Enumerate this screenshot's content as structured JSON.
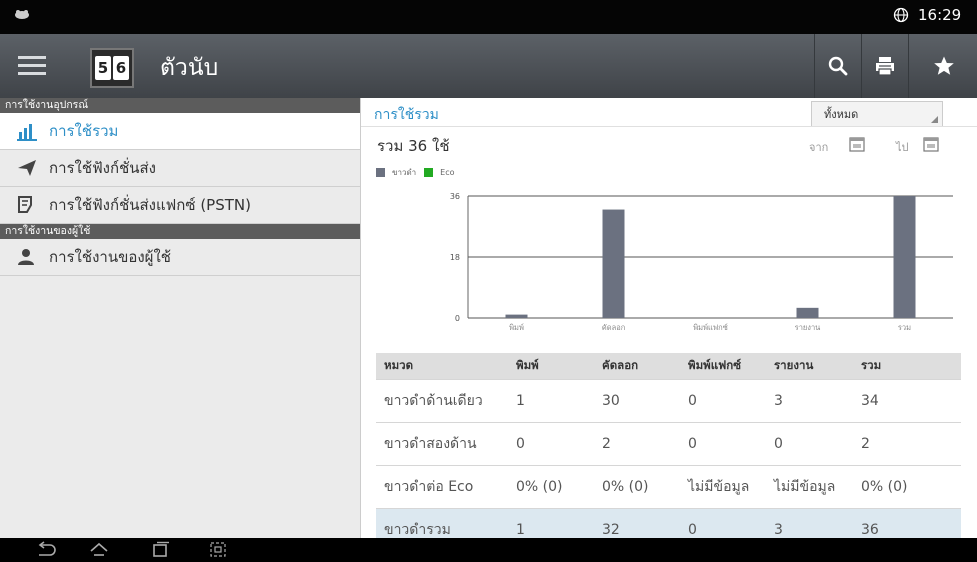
{
  "status_bar": {
    "time": "16:29",
    "left_icon": "notification-icon",
    "globe_icon": "globe-icon"
  },
  "app_bar": {
    "title": "ตัวนับ",
    "logo_left": "5",
    "logo_right": "6",
    "actions": [
      "search-icon",
      "print-icon",
      "star-icon"
    ]
  },
  "sidebar": {
    "sections": [
      {
        "header": "การใช้งานอุปกรณ์",
        "items": [
          {
            "label": "การใช้รวม",
            "icon": "bar-chart-icon",
            "active": true
          },
          {
            "label": "การใช้ฟังก์ชั่นส่ง",
            "icon": "send-icon",
            "active": false
          },
          {
            "label": "การใช้ฟังก์ชั่นส่งแฟกซ์ (PSTN)",
            "icon": "fax-icon",
            "active": false
          }
        ]
      },
      {
        "header": "การใช้งานของผู้ใช้",
        "items": [
          {
            "label": "การใช้งานของผู้ใช้",
            "icon": "user-icon",
            "active": false
          }
        ]
      }
    ]
  },
  "main": {
    "title": "การใช้รวม",
    "filter": {
      "selected": "ทั้งหมด"
    },
    "total_label": "รวม 36 ใช้",
    "from_label": "จาก",
    "to_label": "ไป",
    "legend": [
      {
        "name": "ขาวดำ",
        "color": "#6b7180"
      },
      {
        "name": "Eco",
        "color": "#22aa22"
      }
    ]
  },
  "chart_data": {
    "type": "bar",
    "categories": [
      "พิมพ์",
      "คัดลอก",
      "พิมพ์แฟกซ์",
      "รายงาน",
      "รวม"
    ],
    "series": [
      {
        "name": "ขาวดำ",
        "values": [
          1,
          32,
          0,
          3,
          36
        ],
        "color": "#6b7180"
      },
      {
        "name": "Eco",
        "values": [
          0,
          0,
          0,
          0,
          0
        ],
        "color": "#22aa22"
      }
    ],
    "yticks": [
      "0",
      "18",
      "36"
    ],
    "ylim": [
      0,
      36
    ],
    "grid": true
  },
  "table": {
    "headers": [
      "หมวด",
      "พิมพ์",
      "คัดลอก",
      "พิมพ์แฟกซ์",
      "รายงาน",
      "รวม"
    ],
    "rows": [
      [
        "ขาวดำด้านเดียว",
        "1",
        "30",
        "0",
        "3",
        "34"
      ],
      [
        "ขาวดำสองด้าน",
        "0",
        "2",
        "0",
        "0",
        "2"
      ],
      [
        "ขาวดำต่อ Eco",
        "0% (0)",
        "0% (0)",
        "ไม่มีข้อมูล",
        "ไม่มีข้อมูล",
        "0% (0)"
      ],
      [
        "ขาวดำรวม",
        "1",
        "32",
        "0",
        "3",
        "36"
      ]
    ]
  },
  "nav_bar": {
    "buttons": [
      "back-icon",
      "home-icon",
      "recent-apps-icon",
      "screenshot-icon"
    ]
  }
}
